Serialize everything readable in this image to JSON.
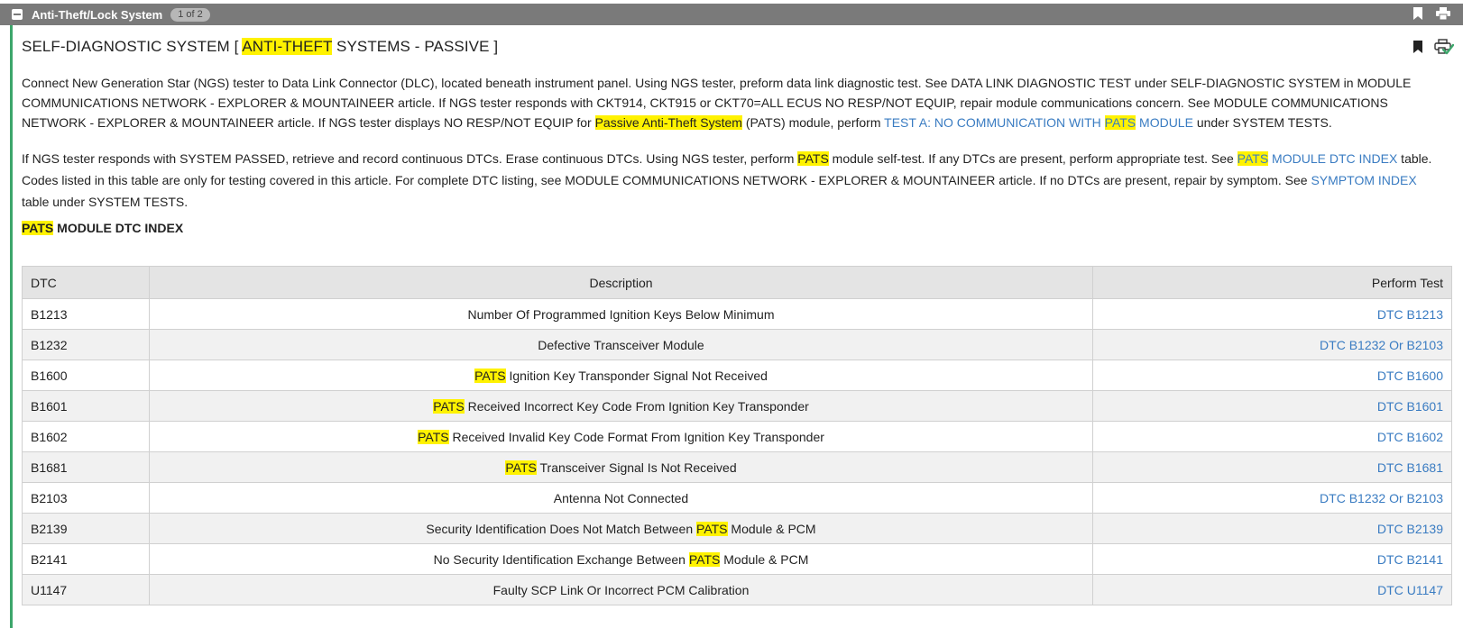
{
  "topbar": {
    "title": "Anti-Theft/Lock System",
    "page_indicator": "1 of 2",
    "icons": [
      "bookmark-icon",
      "print-icon"
    ]
  },
  "heading": {
    "prefix": "SELF-DIAGNOSTIC SYSTEM [ ",
    "highlight": "ANTI-THEFT",
    "suffix": " SYSTEMS - PASSIVE ]",
    "icons": [
      "bookmark-icon",
      "print-check-icon"
    ]
  },
  "paragraph1": {
    "t1": "Connect New Generation Star (NGS) tester to Data Link Connector (DLC), located beneath instrument panel. Using NGS tester, preform data link diagnostic test. See DATA LINK DIAGNOSTIC TEST under SELF-DIAGNOSTIC SYSTEM in MODULE COMMUNICATIONS NETWORK - EXPLORER & MOUNTAINEER article. If NGS tester responds with CKT914, CKT915 or CKT70=ALL ECUS NO RESP/NOT EQUIP, repair module communications concern. See MODULE COMMUNICATIONS NETWORK - EXPLORER & MOUNTAINEER article. If NGS tester displays NO RESP/NOT EQUIP for ",
    "h1": "Passive Anti-Theft System",
    "t2": " (PATS) module, perform ",
    "link_a": "TEST A: NO COMMUNICATION WITH ",
    "link_hl": "PATS",
    "link_b": " MODULE",
    "t3": " under SYSTEM TESTS."
  },
  "paragraph2": {
    "t1": "If NGS tester responds with SYSTEM PASSED, retrieve and record continuous DTCs. Erase continuous DTCs. Using NGS tester, perform ",
    "h1": "PATS",
    "t2": " module self-test. If any DTCs are present, perform appropriate test. See ",
    "link1_hl": "PATS",
    "link1_rest": " MODULE DTC INDEX",
    "t3": " table. Codes listed in this table are only for testing covered in this article. For complete DTC listing, see MODULE COMMUNICATIONS NETWORK - EXPLORER & MOUNTAINEER article. If no DTCs are present, repair by symptom. See ",
    "link2": "SYMPTOM INDEX",
    "t4": " table under SYSTEM TESTS."
  },
  "section": {
    "highlight": "PATS",
    "rest": " MODULE DTC INDEX"
  },
  "table": {
    "headers": [
      "DTC",
      "Description",
      "Perform Test"
    ],
    "rows": [
      {
        "dtc": "B1213",
        "pre": "",
        "hl": "",
        "post": "Number Of Programmed Ignition Keys Below Minimum",
        "test": "DTC B1213"
      },
      {
        "dtc": "B1232",
        "pre": "",
        "hl": "",
        "post": "Defective Transceiver Module",
        "test": "DTC B1232 Or B2103"
      },
      {
        "dtc": "B1600",
        "pre": "",
        "hl": "PATS",
        "post": " Ignition Key Transponder Signal Not Received",
        "test": "DTC B1600"
      },
      {
        "dtc": "B1601",
        "pre": "",
        "hl": "PATS",
        "post": " Received Incorrect Key Code From Ignition Key Transponder",
        "test": "DTC B1601"
      },
      {
        "dtc": "B1602",
        "pre": "",
        "hl": "PATS",
        "post": " Received Invalid Key Code Format From Ignition Key Transponder",
        "test": "DTC B1602"
      },
      {
        "dtc": "B1681",
        "pre": "",
        "hl": "PATS",
        "post": " Transceiver Signal Is Not Received",
        "test": "DTC B1681"
      },
      {
        "dtc": "B2103",
        "pre": "",
        "hl": "",
        "post": "Antenna Not Connected",
        "test": "DTC B1232 Or B2103"
      },
      {
        "dtc": "B2139",
        "pre": "Security Identification Does Not Match Between ",
        "hl": "PATS",
        "post": " Module & PCM",
        "test": "DTC B2139"
      },
      {
        "dtc": "B2141",
        "pre": "No Security Identification Exchange Between ",
        "hl": "PATS",
        "post": " Module & PCM",
        "test": "DTC B2141"
      },
      {
        "dtc": "U1147",
        "pre": "",
        "hl": "",
        "post": "Faulty SCP Link Or Incorrect PCM Calibration",
        "test": "DTC U1147"
      }
    ]
  },
  "colors": {
    "highlight": "#fff200",
    "link": "#3a7cc2",
    "topbar": "#7a7a7a",
    "rail": "#3da66b"
  }
}
